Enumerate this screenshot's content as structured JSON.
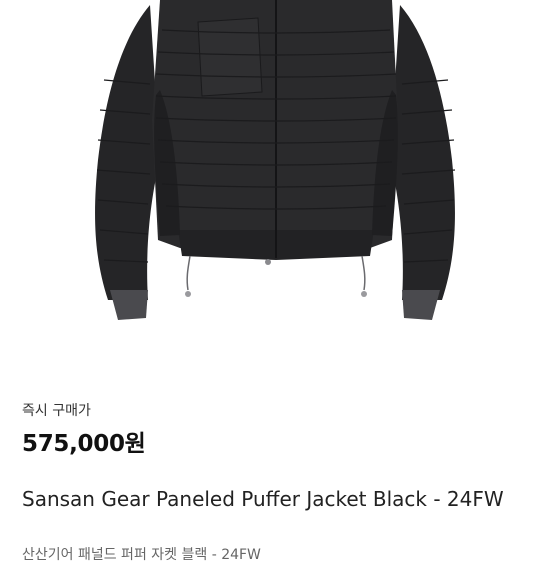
{
  "product": {
    "image_alt_icon": "puffer-jacket-image",
    "purchase_type": "즉시 구매가",
    "price": "575,000원",
    "title": "Sansan Gear Paneled Puffer Jacket Black - 24FW",
    "subtitle": "산산기어 패널드 퍼퍼 자켓 블랙 - 24FW"
  },
  "colors": {
    "jacket": "#2a2a2c",
    "jacket_shadow": "#1b1b1d",
    "panel": "#2f2f31",
    "cuff": "#4a4a4e",
    "background": "#ffffff"
  }
}
